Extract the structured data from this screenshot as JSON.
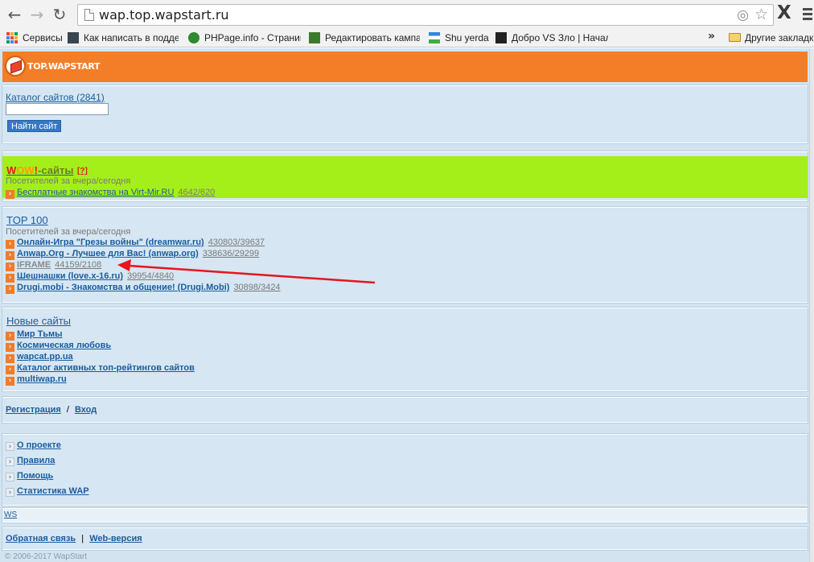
{
  "browser": {
    "url": "wap.top.wapstart.ru",
    "bookmarks": [
      {
        "label": "Сервисы",
        "icon": "apps-icon"
      },
      {
        "label": "Как написать в подде",
        "icon": "mail-icon"
      },
      {
        "label": "PHPage.info - Страница",
        "icon": "phpage-icon"
      },
      {
        "label": "Редактировать кампан",
        "icon": "edit-icon"
      },
      {
        "label": "Shu yerda",
        "icon": "flag-icon"
      },
      {
        "label": "Добро VS Зло | Начало",
        "icon": "game-icon"
      }
    ],
    "more_label": "»",
    "other_bookmarks_label": "Другие закладки"
  },
  "header": {
    "logo_text": "TOP.WAPSTART"
  },
  "catalog": {
    "title": "Каталог сайтов (2841)",
    "search_value": "",
    "search_button": "Найти сайт"
  },
  "wow": {
    "w1": "W",
    "w2": "OW",
    "w3": "!",
    "rest": "-сайты",
    "help": "[?]",
    "visitors_label": "Посетителей за вчера/сегодня",
    "items": [
      {
        "label": "Бесплатные знакомства на Virt-Mir.RU",
        "count": "4642/620"
      }
    ]
  },
  "top100": {
    "title": "TOP 100",
    "visitors_label": "Посетителей за вчера/сегодня",
    "items": [
      {
        "label": "Онлайн-Игра \"Грезы войны\" (dreamwar.ru)",
        "count": "430803/39637"
      },
      {
        "label": "Anwap.Org - Лучшее для Вас! (anwap.org)",
        "count": "338636/29299"
      },
      {
        "label": "IFRAME",
        "count": "44159/2108"
      },
      {
        "label": "Шешнашки (love.x-16.ru)",
        "count": "39954/4840"
      },
      {
        "label": "Drugi.mobi - Знакомства и общение! (Drugi.Mobi)",
        "count": "30898/3424"
      }
    ]
  },
  "new_sites": {
    "title": "Новые сайты",
    "items": [
      {
        "label": "Мир Тьмы"
      },
      {
        "label": "Космическая любовь"
      },
      {
        "label": "wapcat.pp.ua"
      },
      {
        "label": "Каталог активных топ-рейтингов сайтов"
      },
      {
        "label": "multiwap.ru"
      }
    ]
  },
  "auth": {
    "register": "Регистрация",
    "separator": "/",
    "login": "Вход"
  },
  "info_links": {
    "items": [
      {
        "label": "О проекте"
      },
      {
        "label": "Правила"
      },
      {
        "label": "Помощь"
      },
      {
        "label": "Статистика WAP"
      }
    ]
  },
  "ws_link": "WS",
  "footer": {
    "feedback": "Обратная связь",
    "separator": "|",
    "web_version": "Web-версия",
    "copyright": "© 2006-2017 WapStart"
  },
  "colors": {
    "header_orange": "#f47e27",
    "page_blue": "#d3e4f0",
    "wow_green": "#a4ef1a",
    "link_blue": "#1a5d9e",
    "annotation_red": "#e8141e"
  }
}
